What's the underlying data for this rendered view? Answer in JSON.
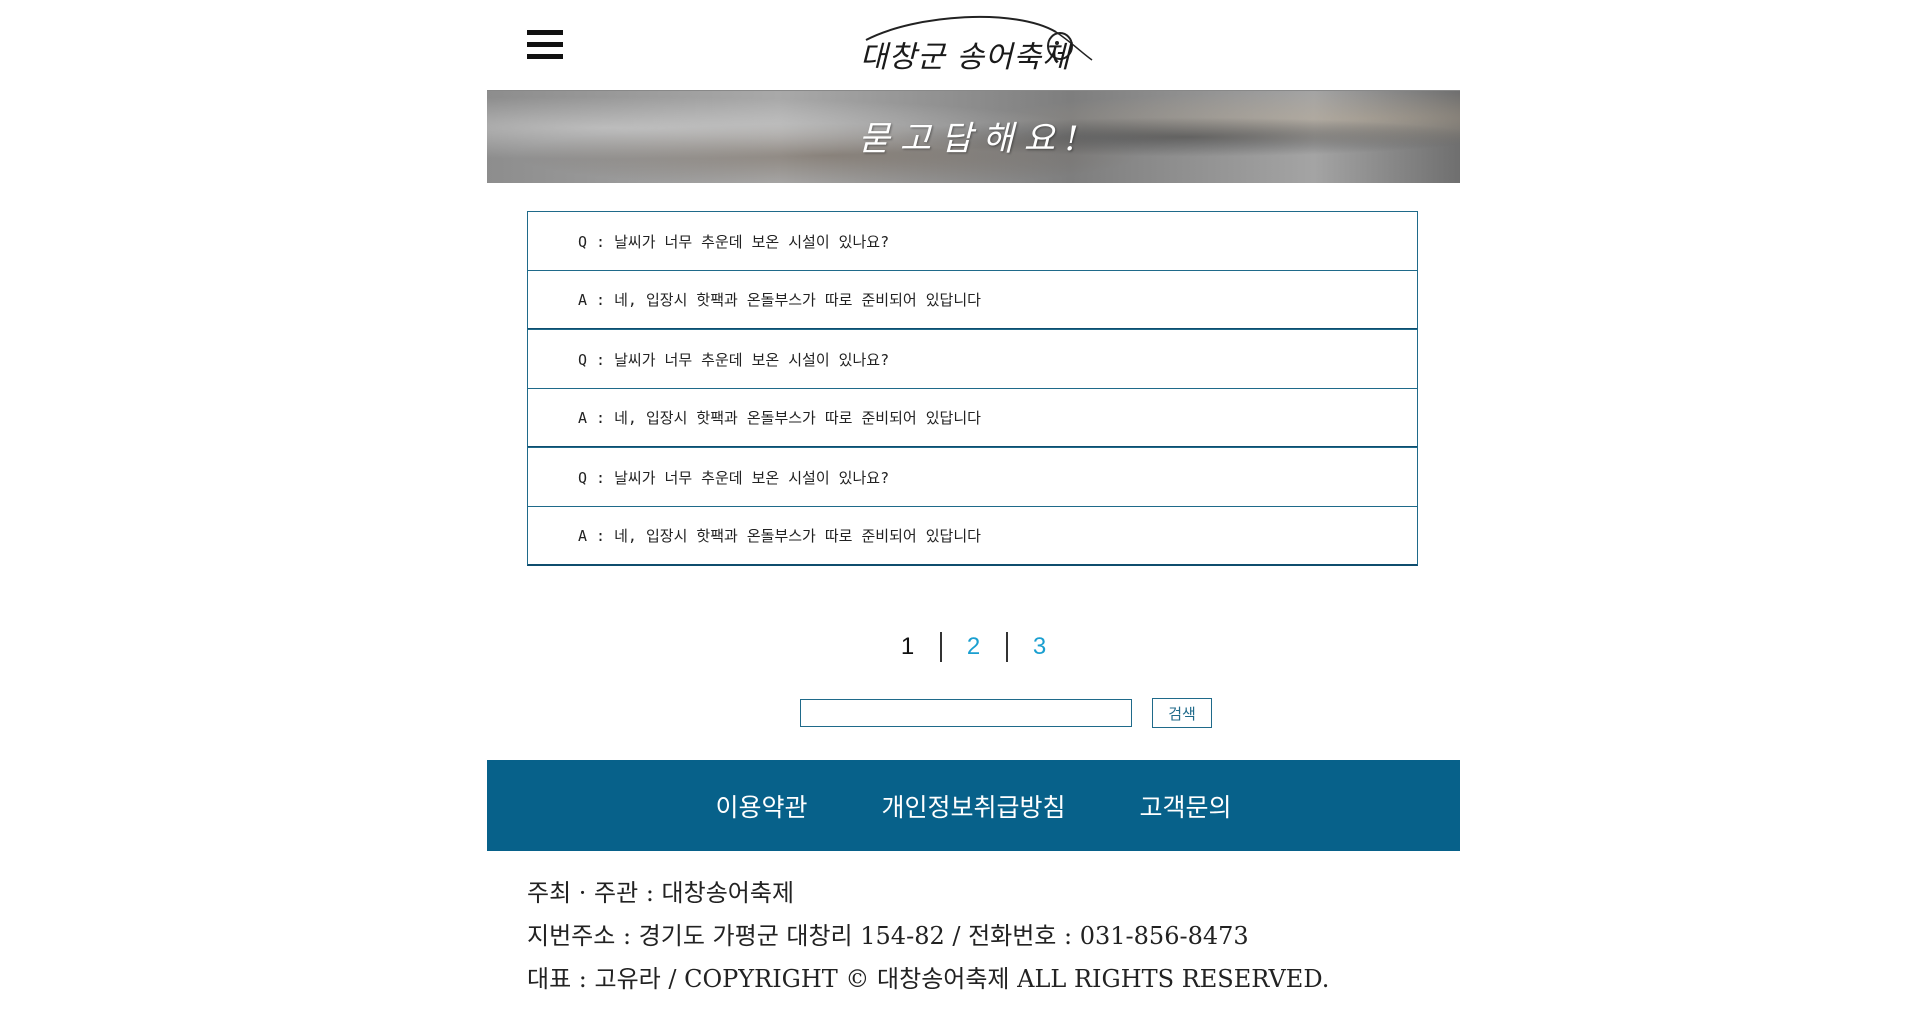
{
  "header": {
    "menu_icon": "hamburger-menu-icon",
    "logo_text": "대창군 송어축제"
  },
  "banner": {
    "title": "묻고답해요!"
  },
  "faq": [
    {
      "question": "Q : 날씨가 너무 추운데 보온 시설이 있나요?",
      "answer": "A : 네, 입장시 핫팩과 온돌부스가 따로 준비되어 있답니다"
    },
    {
      "question": "Q : 날씨가 너무 추운데 보온 시설이 있나요?",
      "answer": "A : 네, 입장시 핫팩과 온돌부스가 따로 준비되어 있답니다"
    },
    {
      "question": "Q : 날씨가 너무 추운데 보온 시설이 있나요?",
      "answer": "A : 네, 입장시 핫팩과 온돌부스가 따로 준비되어 있답니다"
    }
  ],
  "pagination": {
    "pages": [
      "1",
      "2",
      "3"
    ],
    "current": "1"
  },
  "search": {
    "value": "",
    "button_label": "검색"
  },
  "footer_nav": {
    "items": [
      "이용약관",
      "개인정보취급방침",
      "고객문의"
    ]
  },
  "footer_info": {
    "line1": "주최 · 주관 : 대창송어축제",
    "line2": "지번주소 : 경기도 가평군 대창리 154-82  / 전화번호 : 031-856-8473",
    "line3": "대표 : 고유라 / COPYRIGHT © 대창송어축제 ALL RIGHTS RESERVED."
  },
  "colors": {
    "accent": "#07618a",
    "link": "#1a9fd0",
    "border": "#1f6a8a"
  }
}
